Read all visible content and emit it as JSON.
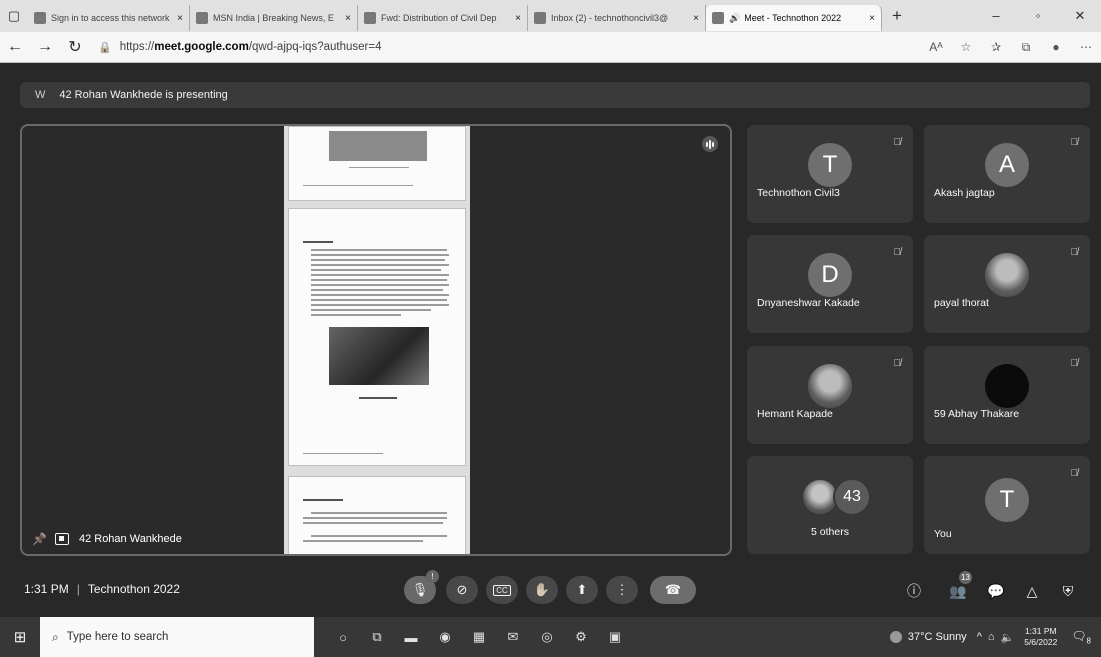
{
  "browser": {
    "tabs": [
      {
        "title": "Sign in to access this network",
        "active": false,
        "close": "×"
      },
      {
        "title": "MSN India | Breaking News, E",
        "active": false,
        "close": "×"
      },
      {
        "title": "Fwd: Distribution of Civil Dep",
        "active": false,
        "close": "×"
      },
      {
        "title": "Inbox (2) - technothoncivil3@",
        "active": false,
        "close": "×"
      },
      {
        "title": "Meet - Technothon 2022",
        "active": true,
        "close": "×"
      }
    ],
    "url_prefix": "https://",
    "url_host": "meet.google.com",
    "url_path": "/qwd-ajpq-iqs?authuser=4"
  },
  "meet": {
    "presenting_initial": "W",
    "presenting_text": "42 Rohan Wankhede is presenting",
    "presenter_label": "42 Rohan Wankhede",
    "participants": [
      {
        "initial": "T",
        "name": "Technothon Civil3",
        "muted": true
      },
      {
        "initial": "A",
        "name": "Akash jagtap",
        "muted": true
      },
      {
        "initial": "D",
        "name": "Dnyaneshwar Kakade",
        "muted": true
      },
      {
        "initial": "",
        "name": "payal thorat",
        "muted": true
      },
      {
        "initial": "",
        "name": "Hemant Kapade",
        "muted": true
      },
      {
        "initial": "",
        "name": "59 Abhay Thakare",
        "muted": true
      },
      {
        "initial": "T",
        "name": "You",
        "muted": true
      }
    ],
    "others": {
      "count": "43",
      "label": "5 others"
    },
    "time": "1:31 PM",
    "meeting_title": "Technothon 2022",
    "mic_badge": "!",
    "people_count": "13",
    "captions_label": "CC"
  },
  "taskbar": {
    "search_placeholder": "Type here to search",
    "weather": "37°C Sunny",
    "time": "1:31 PM",
    "date": "5/6/2022",
    "notifications": "8"
  }
}
